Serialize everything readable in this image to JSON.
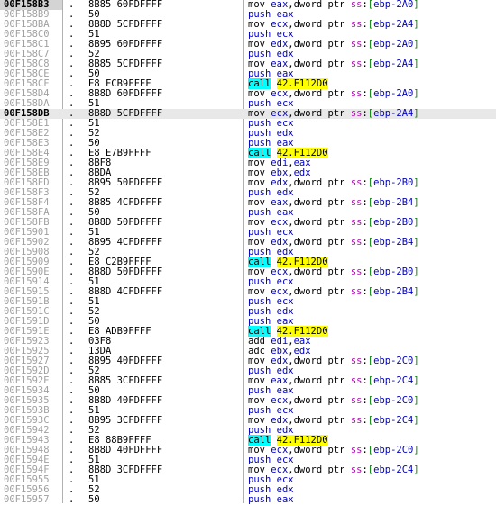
{
  "colors": {
    "call_bg": "#00ffff",
    "target_bg": "#ffff00",
    "register": "#0000c0",
    "segment": "#c000c0",
    "bracket": "#008000"
  },
  "rows": [
    {
      "addr": "00F158B3",
      "mark": ".",
      "hex": "8B85 60FDFFFF",
      "mn": "mov",
      "ops": [
        {
          "t": "eax",
          "c": "reg"
        },
        {
          "t": ",",
          "c": "sym"
        },
        {
          "t": "dword ptr ",
          "c": "kw"
        },
        {
          "t": "ss",
          "c": "seg"
        },
        {
          "t": ":",
          "c": "sym"
        },
        {
          "t": "[",
          "c": "br"
        },
        {
          "t": "ebp-2A0",
          "c": "off"
        },
        {
          "t": "]",
          "c": "br"
        }
      ]
    },
    {
      "addr": "00F158B9",
      "mark": ".",
      "hex": "50",
      "mn": "push",
      "ops": [
        {
          "t": "eax",
          "c": "reg"
        }
      ]
    },
    {
      "addr": "00F158BA",
      "mark": ".",
      "hex": "8B8D 5CFDFFFF",
      "mn": "mov",
      "ops": [
        {
          "t": "ecx",
          "c": "reg"
        },
        {
          "t": ",",
          "c": "sym"
        },
        {
          "t": "dword ptr ",
          "c": "kw"
        },
        {
          "t": "ss",
          "c": "seg"
        },
        {
          "t": ":",
          "c": "sym"
        },
        {
          "t": "[",
          "c": "br"
        },
        {
          "t": "ebp-2A4",
          "c": "off"
        },
        {
          "t": "]",
          "c": "br"
        }
      ]
    },
    {
      "addr": "00F158C0",
      "mark": ".",
      "hex": "51",
      "mn": "push",
      "ops": [
        {
          "t": "ecx",
          "c": "reg"
        }
      ]
    },
    {
      "addr": "00F158C1",
      "mark": ".",
      "hex": "8B95 60FDFFFF",
      "mn": "mov",
      "ops": [
        {
          "t": "edx",
          "c": "reg"
        },
        {
          "t": ",",
          "c": "sym"
        },
        {
          "t": "dword ptr ",
          "c": "kw"
        },
        {
          "t": "ss",
          "c": "seg"
        },
        {
          "t": ":",
          "c": "sym"
        },
        {
          "t": "[",
          "c": "br"
        },
        {
          "t": "ebp-2A0",
          "c": "off"
        },
        {
          "t": "]",
          "c": "br"
        }
      ]
    },
    {
      "addr": "00F158C7",
      "mark": ".",
      "hex": "52",
      "mn": "push",
      "ops": [
        {
          "t": "edx",
          "c": "reg"
        }
      ]
    },
    {
      "addr": "00F158C8",
      "mark": ".",
      "hex": "8B85 5CFDFFFF",
      "mn": "mov",
      "ops": [
        {
          "t": "eax",
          "c": "reg"
        },
        {
          "t": ",",
          "c": "sym"
        },
        {
          "t": "dword ptr ",
          "c": "kw"
        },
        {
          "t": "ss",
          "c": "seg"
        },
        {
          "t": ":",
          "c": "sym"
        },
        {
          "t": "[",
          "c": "br"
        },
        {
          "t": "ebp-2A4",
          "c": "off"
        },
        {
          "t": "]",
          "c": "br"
        }
      ]
    },
    {
      "addr": "00F158CE",
      "mark": ".",
      "hex": "50",
      "mn": "push",
      "ops": [
        {
          "t": "eax",
          "c": "reg"
        }
      ]
    },
    {
      "addr": "00F158CF",
      "mark": ".",
      "hex": "E8 FCB9FFFF",
      "mn": "call",
      "call": true,
      "target": "42.F112D0"
    },
    {
      "addr": "00F158D4",
      "mark": ".",
      "hex": "8B8D 60FDFFFF",
      "mn": "mov",
      "ops": [
        {
          "t": "ecx",
          "c": "reg"
        },
        {
          "t": ",",
          "c": "sym"
        },
        {
          "t": "dword ptr ",
          "c": "kw"
        },
        {
          "t": "ss",
          "c": "seg"
        },
        {
          "t": ":",
          "c": "sym"
        },
        {
          "t": "[",
          "c": "br"
        },
        {
          "t": "ebp-2A0",
          "c": "off"
        },
        {
          "t": "]",
          "c": "br"
        }
      ]
    },
    {
      "addr": "00F158DA",
      "mark": ".",
      "hex": "51",
      "mn": "push",
      "ops": [
        {
          "t": "ecx",
          "c": "reg"
        }
      ]
    },
    {
      "addr": "00F158DB",
      "mark": ".",
      "hex": "8B8D 5CFDFFFF",
      "mn": "mov",
      "cur": true,
      "ops": [
        {
          "t": "ecx",
          "c": "reg"
        },
        {
          "t": ",",
          "c": "sym"
        },
        {
          "t": "dword ptr ",
          "c": "kw"
        },
        {
          "t": "ss",
          "c": "seg"
        },
        {
          "t": ":",
          "c": "sym"
        },
        {
          "t": "[",
          "c": "br"
        },
        {
          "t": "ebp-2A4",
          "c": "off"
        },
        {
          "t": "]",
          "c": "br"
        }
      ]
    },
    {
      "addr": "00F158E1",
      "mark": ".",
      "hex": "51",
      "mn": "push",
      "ops": [
        {
          "t": "ecx",
          "c": "reg"
        }
      ]
    },
    {
      "addr": "00F158E2",
      "mark": ".",
      "hex": "52",
      "mn": "push",
      "ops": [
        {
          "t": "edx",
          "c": "reg"
        }
      ]
    },
    {
      "addr": "00F158E3",
      "mark": ".",
      "hex": "50",
      "mn": "push",
      "ops": [
        {
          "t": "eax",
          "c": "reg"
        }
      ]
    },
    {
      "addr": "00F158E4",
      "mark": ".",
      "hex": "E8 E7B9FFFF",
      "mn": "call",
      "call": true,
      "target": "42.F112D0"
    },
    {
      "addr": "00F158E9",
      "mark": ".",
      "hex": "8BF8",
      "mn": "mov",
      "ops": [
        {
          "t": "edi",
          "c": "reg"
        },
        {
          "t": ",",
          "c": "sym"
        },
        {
          "t": "eax",
          "c": "reg"
        }
      ]
    },
    {
      "addr": "00F158EB",
      "mark": ".",
      "hex": "8BDA",
      "mn": "mov",
      "ops": [
        {
          "t": "ebx",
          "c": "reg"
        },
        {
          "t": ",",
          "c": "sym"
        },
        {
          "t": "edx",
          "c": "reg"
        }
      ]
    },
    {
      "addr": "00F158ED",
      "mark": ".",
      "hex": "8B95 50FDFFFF",
      "mn": "mov",
      "ops": [
        {
          "t": "edx",
          "c": "reg"
        },
        {
          "t": ",",
          "c": "sym"
        },
        {
          "t": "dword ptr ",
          "c": "kw"
        },
        {
          "t": "ss",
          "c": "seg"
        },
        {
          "t": ":",
          "c": "sym"
        },
        {
          "t": "[",
          "c": "br"
        },
        {
          "t": "ebp-2B0",
          "c": "off"
        },
        {
          "t": "]",
          "c": "br"
        }
      ]
    },
    {
      "addr": "00F158F3",
      "mark": ".",
      "hex": "52",
      "mn": "push",
      "ops": [
        {
          "t": "edx",
          "c": "reg"
        }
      ]
    },
    {
      "addr": "00F158F4",
      "mark": ".",
      "hex": "8B85 4CFDFFFF",
      "mn": "mov",
      "ops": [
        {
          "t": "eax",
          "c": "reg"
        },
        {
          "t": ",",
          "c": "sym"
        },
        {
          "t": "dword ptr ",
          "c": "kw"
        },
        {
          "t": "ss",
          "c": "seg"
        },
        {
          "t": ":",
          "c": "sym"
        },
        {
          "t": "[",
          "c": "br"
        },
        {
          "t": "ebp-2B4",
          "c": "off"
        },
        {
          "t": "]",
          "c": "br"
        }
      ]
    },
    {
      "addr": "00F158FA",
      "mark": ".",
      "hex": "50",
      "mn": "push",
      "ops": [
        {
          "t": "eax",
          "c": "reg"
        }
      ]
    },
    {
      "addr": "00F158FB",
      "mark": ".",
      "hex": "8B8D 50FDFFFF",
      "mn": "mov",
      "ops": [
        {
          "t": "ecx",
          "c": "reg"
        },
        {
          "t": ",",
          "c": "sym"
        },
        {
          "t": "dword ptr ",
          "c": "kw"
        },
        {
          "t": "ss",
          "c": "seg"
        },
        {
          "t": ":",
          "c": "sym"
        },
        {
          "t": "[",
          "c": "br"
        },
        {
          "t": "ebp-2B0",
          "c": "off"
        },
        {
          "t": "]",
          "c": "br"
        }
      ]
    },
    {
      "addr": "00F15901",
      "mark": ".",
      "hex": "51",
      "mn": "push",
      "ops": [
        {
          "t": "ecx",
          "c": "reg"
        }
      ]
    },
    {
      "addr": "00F15902",
      "mark": ".",
      "hex": "8B95 4CFDFFFF",
      "mn": "mov",
      "ops": [
        {
          "t": "edx",
          "c": "reg"
        },
        {
          "t": ",",
          "c": "sym"
        },
        {
          "t": "dword ptr ",
          "c": "kw"
        },
        {
          "t": "ss",
          "c": "seg"
        },
        {
          "t": ":",
          "c": "sym"
        },
        {
          "t": "[",
          "c": "br"
        },
        {
          "t": "ebp-2B4",
          "c": "off"
        },
        {
          "t": "]",
          "c": "br"
        }
      ]
    },
    {
      "addr": "00F15908",
      "mark": ".",
      "hex": "52",
      "mn": "push",
      "ops": [
        {
          "t": "edx",
          "c": "reg"
        }
      ]
    },
    {
      "addr": "00F15909",
      "mark": ".",
      "hex": "E8 C2B9FFFF",
      "mn": "call",
      "call": true,
      "target": "42.F112D0"
    },
    {
      "addr": "00F1590E",
      "mark": ".",
      "hex": "8B8D 50FDFFFF",
      "mn": "mov",
      "ops": [
        {
          "t": "ecx",
          "c": "reg"
        },
        {
          "t": ",",
          "c": "sym"
        },
        {
          "t": "dword ptr ",
          "c": "kw"
        },
        {
          "t": "ss",
          "c": "seg"
        },
        {
          "t": ":",
          "c": "sym"
        },
        {
          "t": "[",
          "c": "br"
        },
        {
          "t": "ebp-2B0",
          "c": "off"
        },
        {
          "t": "]",
          "c": "br"
        }
      ]
    },
    {
      "addr": "00F15914",
      "mark": ".",
      "hex": "51",
      "mn": "push",
      "ops": [
        {
          "t": "ecx",
          "c": "reg"
        }
      ]
    },
    {
      "addr": "00F15915",
      "mark": ".",
      "hex": "8B8D 4CFDFFFF",
      "mn": "mov",
      "ops": [
        {
          "t": "ecx",
          "c": "reg"
        },
        {
          "t": ",",
          "c": "sym"
        },
        {
          "t": "dword ptr ",
          "c": "kw"
        },
        {
          "t": "ss",
          "c": "seg"
        },
        {
          "t": ":",
          "c": "sym"
        },
        {
          "t": "[",
          "c": "br"
        },
        {
          "t": "ebp-2B4",
          "c": "off"
        },
        {
          "t": "]",
          "c": "br"
        }
      ]
    },
    {
      "addr": "00F1591B",
      "mark": ".",
      "hex": "51",
      "mn": "push",
      "ops": [
        {
          "t": "ecx",
          "c": "reg"
        }
      ]
    },
    {
      "addr": "00F1591C",
      "mark": ".",
      "hex": "52",
      "mn": "push",
      "ops": [
        {
          "t": "edx",
          "c": "reg"
        }
      ]
    },
    {
      "addr": "00F1591D",
      "mark": ".",
      "hex": "50",
      "mn": "push",
      "ops": [
        {
          "t": "eax",
          "c": "reg"
        }
      ]
    },
    {
      "addr": "00F1591E",
      "mark": ".",
      "hex": "E8 ADB9FFFF",
      "mn": "call",
      "call": true,
      "target": "42.F112D0"
    },
    {
      "addr": "00F15923",
      "mark": ".",
      "hex": "03F8",
      "mn": "add",
      "ops": [
        {
          "t": "edi",
          "c": "reg"
        },
        {
          "t": ",",
          "c": "sym"
        },
        {
          "t": "eax",
          "c": "reg"
        }
      ]
    },
    {
      "addr": "00F15925",
      "mark": ".",
      "hex": "13DA",
      "mn": "adc",
      "ops": [
        {
          "t": "ebx",
          "c": "reg"
        },
        {
          "t": ",",
          "c": "sym"
        },
        {
          "t": "edx",
          "c": "reg"
        }
      ]
    },
    {
      "addr": "00F15927",
      "mark": ".",
      "hex": "8B95 40FDFFFF",
      "mn": "mov",
      "ops": [
        {
          "t": "edx",
          "c": "reg"
        },
        {
          "t": ",",
          "c": "sym"
        },
        {
          "t": "dword ptr ",
          "c": "kw"
        },
        {
          "t": "ss",
          "c": "seg"
        },
        {
          "t": ":",
          "c": "sym"
        },
        {
          "t": "[",
          "c": "br"
        },
        {
          "t": "ebp-2C0",
          "c": "off"
        },
        {
          "t": "]",
          "c": "br"
        }
      ]
    },
    {
      "addr": "00F1592D",
      "mark": ".",
      "hex": "52",
      "mn": "push",
      "ops": [
        {
          "t": "edx",
          "c": "reg"
        }
      ]
    },
    {
      "addr": "00F1592E",
      "mark": ".",
      "hex": "8B85 3CFDFFFF",
      "mn": "mov",
      "ops": [
        {
          "t": "eax",
          "c": "reg"
        },
        {
          "t": ",",
          "c": "sym"
        },
        {
          "t": "dword ptr ",
          "c": "kw"
        },
        {
          "t": "ss",
          "c": "seg"
        },
        {
          "t": ":",
          "c": "sym"
        },
        {
          "t": "[",
          "c": "br"
        },
        {
          "t": "ebp-2C4",
          "c": "off"
        },
        {
          "t": "]",
          "c": "br"
        }
      ]
    },
    {
      "addr": "00F15934",
      "mark": ".",
      "hex": "50",
      "mn": "push",
      "ops": [
        {
          "t": "eax",
          "c": "reg"
        }
      ]
    },
    {
      "addr": "00F15935",
      "mark": ".",
      "hex": "8B8D 40FDFFFF",
      "mn": "mov",
      "ops": [
        {
          "t": "ecx",
          "c": "reg"
        },
        {
          "t": ",",
          "c": "sym"
        },
        {
          "t": "dword ptr ",
          "c": "kw"
        },
        {
          "t": "ss",
          "c": "seg"
        },
        {
          "t": ":",
          "c": "sym"
        },
        {
          "t": "[",
          "c": "br"
        },
        {
          "t": "ebp-2C0",
          "c": "off"
        },
        {
          "t": "]",
          "c": "br"
        }
      ]
    },
    {
      "addr": "00F1593B",
      "mark": ".",
      "hex": "51",
      "mn": "push",
      "ops": [
        {
          "t": "ecx",
          "c": "reg"
        }
      ]
    },
    {
      "addr": "00F1593C",
      "mark": ".",
      "hex": "8B95 3CFDFFFF",
      "mn": "mov",
      "ops": [
        {
          "t": "edx",
          "c": "reg"
        },
        {
          "t": ",",
          "c": "sym"
        },
        {
          "t": "dword ptr ",
          "c": "kw"
        },
        {
          "t": "ss",
          "c": "seg"
        },
        {
          "t": ":",
          "c": "sym"
        },
        {
          "t": "[",
          "c": "br"
        },
        {
          "t": "ebp-2C4",
          "c": "off"
        },
        {
          "t": "]",
          "c": "br"
        }
      ]
    },
    {
      "addr": "00F15942",
      "mark": ".",
      "hex": "52",
      "mn": "push",
      "ops": [
        {
          "t": "edx",
          "c": "reg"
        }
      ]
    },
    {
      "addr": "00F15943",
      "mark": ".",
      "hex": "E8 88B9FFFF",
      "mn": "call",
      "call": true,
      "target": "42.F112D0"
    },
    {
      "addr": "00F15948",
      "mark": ".",
      "hex": "8B8D 40FDFFFF",
      "mn": "mov",
      "ops": [
        {
          "t": "ecx",
          "c": "reg"
        },
        {
          "t": ",",
          "c": "sym"
        },
        {
          "t": "dword ptr ",
          "c": "kw"
        },
        {
          "t": "ss",
          "c": "seg"
        },
        {
          "t": ":",
          "c": "sym"
        },
        {
          "t": "[",
          "c": "br"
        },
        {
          "t": "ebp-2C0",
          "c": "off"
        },
        {
          "t": "]",
          "c": "br"
        }
      ]
    },
    {
      "addr": "00F1594E",
      "mark": ".",
      "hex": "51",
      "mn": "push",
      "ops": [
        {
          "t": "ecx",
          "c": "reg"
        }
      ]
    },
    {
      "addr": "00F1594F",
      "mark": ".",
      "hex": "8B8D 3CFDFFFF",
      "mn": "mov",
      "ops": [
        {
          "t": "ecx",
          "c": "reg"
        },
        {
          "t": ",",
          "c": "sym"
        },
        {
          "t": "dword ptr ",
          "c": "kw"
        },
        {
          "t": "ss",
          "c": "seg"
        },
        {
          "t": ":",
          "c": "sym"
        },
        {
          "t": "[",
          "c": "br"
        },
        {
          "t": "ebp-2C4",
          "c": "off"
        },
        {
          "t": "]",
          "c": "br"
        }
      ]
    },
    {
      "addr": "00F15955",
      "mark": ".",
      "hex": "51",
      "mn": "push",
      "ops": [
        {
          "t": "ecx",
          "c": "reg"
        }
      ]
    },
    {
      "addr": "00F15956",
      "mark": ".",
      "hex": "52",
      "mn": "push",
      "ops": [
        {
          "t": "edx",
          "c": "reg"
        }
      ]
    },
    {
      "addr": "00F15957",
      "mark": ".",
      "hex": "50",
      "mn": "push",
      "ops": [
        {
          "t": "eax",
          "c": "reg"
        }
      ]
    }
  ]
}
